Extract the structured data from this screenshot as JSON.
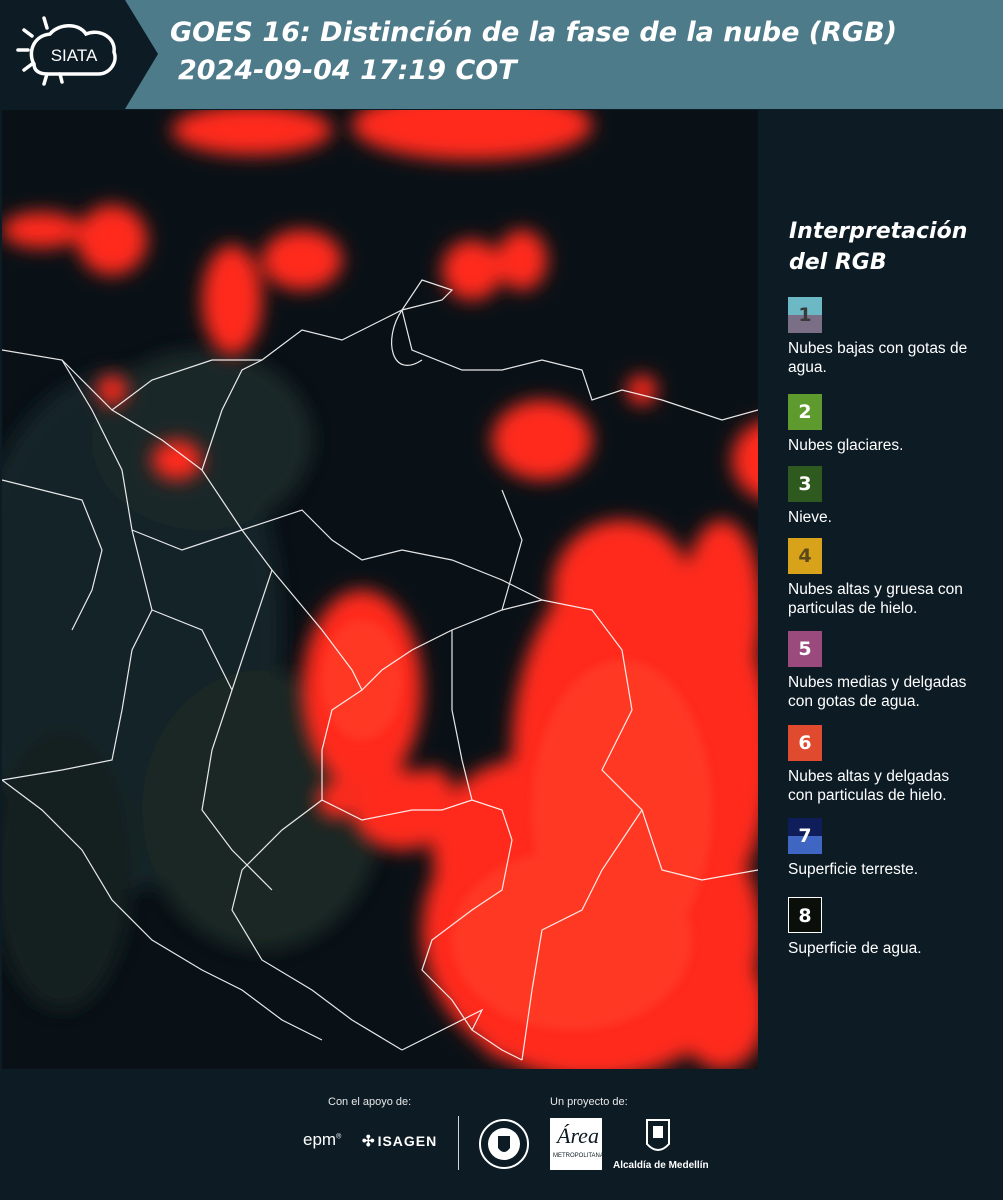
{
  "header": {
    "logo_text": "SIATA",
    "title_line1": "GOES 16: Distinción de la fase de la nube (RGB)",
    "title_line2": "2024-09-04 17:19 COT"
  },
  "legend": {
    "title_line1": "Interpretación",
    "title_line2": "del RGB",
    "items": [
      {
        "num": "1",
        "label": "Nubes bajas con gotas de agua.",
        "color_top": "#6cb8c4",
        "color_bottom": "#7a6f86",
        "num_color": "#3a3a3a"
      },
      {
        "num": "2",
        "label": "Nubes glaciares.",
        "color_top": "#5e9a2e",
        "color_bottom": "#5e9a2e",
        "num_color": "#ffffff"
      },
      {
        "num": "3",
        "label": "Nieve.",
        "color_top": "#2f5a1f",
        "color_bottom": "#2f5a1f",
        "num_color": "#ffffff"
      },
      {
        "num": "4",
        "label": "Nubes altas y gruesa con particulas de hielo.",
        "color_top": "#d9a21b",
        "color_bottom": "#d9a21b",
        "num_color": "#5a4a1a"
      },
      {
        "num": "5",
        "label": "Nubes medias y delgadas con gotas de agua.",
        "color_top": "#9b4a7e",
        "color_bottom": "#9b4a7e",
        "num_color": "#ffffff"
      },
      {
        "num": "6",
        "label": "Nubes altas y delgadas con particulas de hielo.",
        "color_top": "#e04a2f",
        "color_bottom": "#e04a2f",
        "num_color": "#ffffff"
      },
      {
        "num": "7",
        "label": "Superficie terreste.",
        "color_top": "#0f1d5a",
        "color_bottom": "#3f66c2",
        "num_color": "#ffffff"
      },
      {
        "num": "8",
        "label": "Superficie de agua.",
        "color_top": "#0a0f0a",
        "color_bottom": "#0a0f0a",
        "num_color": "#ffffff"
      }
    ]
  },
  "footer": {
    "support_label": "Con el apoyo de:",
    "project_label": "Un proyecto de:",
    "sponsor1": "epm",
    "sponsor2": "ISAGEN",
    "partner_area_line1": "Área",
    "partner_area_line2": "METROPOLITANA",
    "partner_alcaldia": "Alcaldía de Medellín"
  },
  "colors": {
    "header_bg": "#4e7b8a",
    "page_bg": "#0d1b24",
    "cloud_red": "#ff2a1a",
    "border_white": "#ffffff"
  }
}
